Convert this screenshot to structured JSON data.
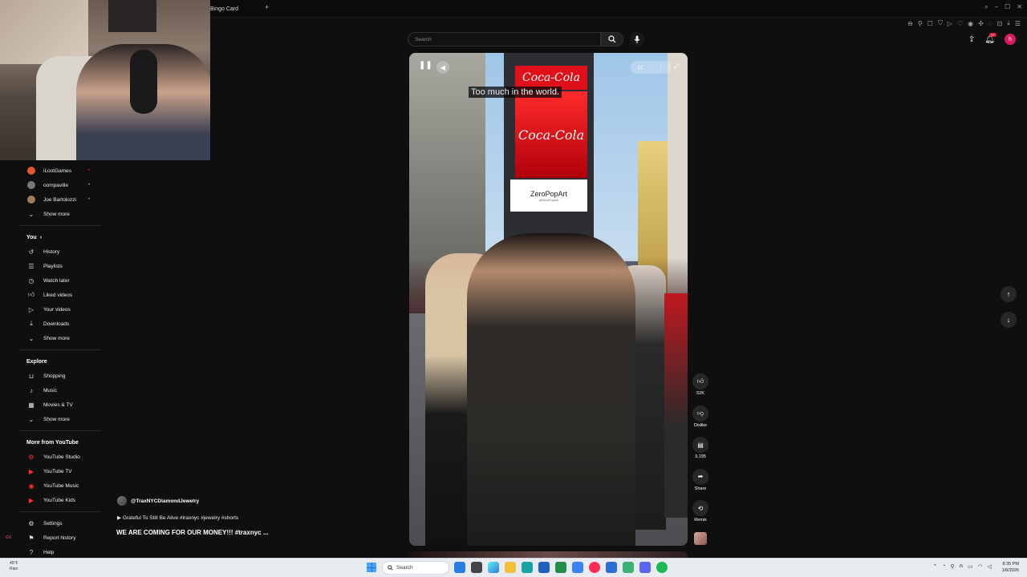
{
  "browser": {
    "tab_title": "Bingo Card",
    "new_tab": "+"
  },
  "header": {
    "search_placeholder": "Search",
    "avatar_letter": "h",
    "notif_count": "9+"
  },
  "sidebar": {
    "subscriptions": [
      {
        "label": "iLootGames",
        "color": "#e05a2b"
      },
      {
        "label": "oompaville",
        "color": "#777777"
      },
      {
        "label": "Joe Bartolozzi",
        "color": "#a07a5a"
      }
    ],
    "subs_show_more": "Show more",
    "you_title": "You",
    "you_items": [
      {
        "label": "History",
        "icon": "history-icon"
      },
      {
        "label": "Playlists",
        "icon": "playlists-icon"
      },
      {
        "label": "Watch later",
        "icon": "watch-later-icon"
      },
      {
        "label": "Liked videos",
        "icon": "like-icon"
      },
      {
        "label": "Your videos",
        "icon": "your-videos-icon"
      },
      {
        "label": "Downloads",
        "icon": "download-icon"
      }
    ],
    "you_show_more": "Show more",
    "explore_title": "Explore",
    "explore_items": [
      {
        "label": "Shopping",
        "icon": "shopping-bag-icon"
      },
      {
        "label": "Music",
        "icon": "music-note-icon"
      },
      {
        "label": "Movies & TV",
        "icon": "film-icon"
      }
    ],
    "explore_show_more": "Show more",
    "more_title": "More from YouTube",
    "more_items": [
      {
        "label": "YouTube Studio"
      },
      {
        "label": "YouTube TV"
      },
      {
        "label": "YouTube Music"
      },
      {
        "label": "YouTube Kids"
      }
    ],
    "bottom_items": [
      {
        "label": "Settings",
        "icon": "gear-icon"
      },
      {
        "label": "Report history",
        "icon": "flag-icon"
      },
      {
        "label": "Help",
        "icon": "help-icon"
      }
    ]
  },
  "video": {
    "caption": "Too much in the world.",
    "sign_coke": "Coca-Cola",
    "sign_zeropop": "ZeroPopArt",
    "sign_zeropop_handle": "@ZeroPopArt",
    "channel": "@TraxNYCDiamondJewelry",
    "description": "Grateful To Still Be Alive #traxnyc #jewelry #shorts",
    "title": "WE ARE COMING FOR OUR MONEY!!! #traxnyc ..."
  },
  "actions": {
    "like_count": "52K",
    "dislike_label": "Dislike",
    "comments_count": "3,195",
    "share_label": "Share",
    "remix_label": "Remix"
  },
  "taskbar": {
    "temp": "45°F",
    "weather": "Rain",
    "search": "Search",
    "time": "8:35 PM",
    "date": "1/8/2026"
  }
}
